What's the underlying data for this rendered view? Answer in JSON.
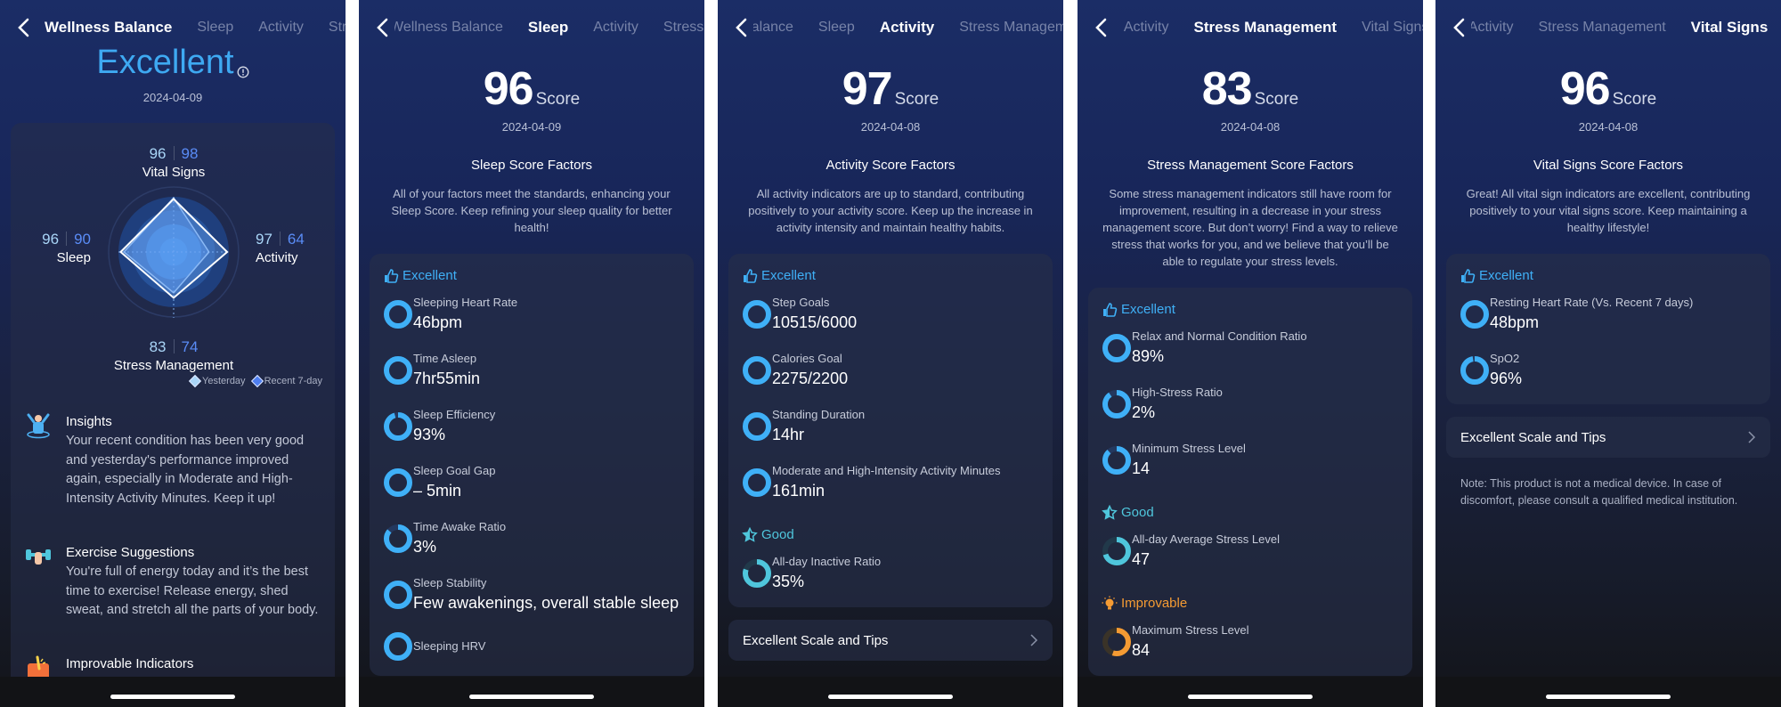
{
  "tabs": [
    "Wellness Balance",
    "Sleep",
    "Activity",
    "Stress Management",
    "Vital Signs"
  ],
  "colors": {
    "excellent": "#3fb0f7",
    "good": "#4fc6dc",
    "improvable": "#f59b33",
    "rating": "#3ea9f2",
    "yesterday": "#a9d5f7",
    "recent": "#4f7ff0"
  },
  "overview": {
    "active_tab": 0,
    "rating": "Excellent",
    "date": "2024-04-09",
    "radar": {
      "axes": [
        {
          "label": "Vital Signs",
          "yesterday": 96,
          "recent": 98
        },
        {
          "label": "Activity",
          "yesterday": 97,
          "recent": 64
        },
        {
          "label": "Stress Management",
          "yesterday": 83,
          "recent": 74
        },
        {
          "label": "Sleep",
          "yesterday": 96,
          "recent": 90
        }
      ],
      "legend": {
        "yesterday": "Yesterday",
        "recent": "Recent 7-day"
      }
    },
    "insights": [
      {
        "icon": "person-cheering-icon",
        "title": "Insights",
        "body": "Your recent condition has been very good and yesterday's performance improved again, especially in Moderate and High-Intensity Activity Minutes. Keep it up!"
      },
      {
        "icon": "dumbbell-icon",
        "title": "Exercise Suggestions",
        "body": "You're full of energy today and it’s the best time to exercise! Release energy, shed sweat, and stretch all the parts of your body."
      },
      {
        "icon": "alert-box-icon",
        "title": "Improvable Indicators",
        "body": ""
      }
    ]
  },
  "details": [
    {
      "active_tab": 1,
      "score": "96",
      "score_label": "Score",
      "date": "2024-04-09",
      "factors_title": "Sleep Score Factors",
      "description": "All of your factors meet the standards, enhancing your Sleep Score. Keep refining your sleep quality for better health!",
      "groups": [
        {
          "level": "Excellent",
          "kind": "excellent",
          "items": [
            {
              "label": "Sleeping Heart Rate",
              "value": "46bpm",
              "progress": 1
            },
            {
              "label": "Time Asleep",
              "value": "7hr55min",
              "progress": 1
            },
            {
              "label": "Sleep Efficiency",
              "value": "93%",
              "progress": 0.95
            },
            {
              "label": "Sleep Goal Gap",
              "value": "– 5min",
              "progress": 1
            },
            {
              "label": "Time Awake Ratio",
              "value": "3%",
              "progress": 0.86
            },
            {
              "label": "Sleep Stability",
              "value": "Few awakenings, overall stable sleep",
              "progress": 1
            },
            {
              "label": "Sleeping HRV",
              "value": "",
              "progress": 1
            }
          ]
        }
      ]
    },
    {
      "active_tab": 2,
      "score": "97",
      "score_label": "Score",
      "date": "2024-04-08",
      "factors_title": "Activity Score Factors",
      "description": "All activity indicators are up to standard, contributing positively to your activity score. Keep up the increase in activity intensity and maintain healthy habits.",
      "groups": [
        {
          "level": "Excellent",
          "kind": "excellent",
          "items": [
            {
              "label": "Step Goals",
              "value": "10515/6000",
              "progress": 1
            },
            {
              "label": "Calories Goal",
              "value": "2275/2200",
              "progress": 1
            },
            {
              "label": "Standing Duration",
              "value": "14hr",
              "progress": 1
            },
            {
              "label": "Moderate and High-Intensity Activity Minutes",
              "value": "161min",
              "progress": 1
            }
          ]
        },
        {
          "level": "Good",
          "kind": "good",
          "items": [
            {
              "label": "All-day Inactive Ratio",
              "value": "35%",
              "progress": 0.8
            }
          ]
        }
      ],
      "tips_label": "Excellent Scale and Tips"
    },
    {
      "active_tab": 3,
      "score": "83",
      "score_label": "Score",
      "date": "2024-04-08",
      "factors_title": "Stress Management Score Factors",
      "description": "Some stress management indicators still have room for improvement, resulting in a decrease in your stress management score. But don’t worry! Find a way to relieve stress that works for you, and we believe that you’ll be able to regulate your stress levels.",
      "groups": [
        {
          "level": "Excellent",
          "kind": "excellent",
          "items": [
            {
              "label": "Relax and Normal Condition Ratio",
              "value": "89%",
              "progress": 1
            },
            {
              "label": "High-Stress Ratio",
              "value": "2%",
              "progress": 0.9
            },
            {
              "label": "Minimum Stress Level",
              "value": "14",
              "progress": 0.88
            }
          ]
        },
        {
          "level": "Good",
          "kind": "good",
          "items": [
            {
              "label": "All-day Average Stress Level",
              "value": "47",
              "progress": 0.7
            }
          ]
        },
        {
          "level": "Improvable",
          "kind": "improvable",
          "items": [
            {
              "label": "Maximum Stress Level",
              "value": "84",
              "progress": 0.55
            }
          ]
        }
      ]
    },
    {
      "active_tab": 4,
      "score": "96",
      "score_label": "Score",
      "date": "2024-04-08",
      "factors_title": "Vital Signs Score Factors",
      "description": "Great! All vital sign indicators are excellent, contributing positively to your vital signs score. Keep maintaining a healthy lifestyle!",
      "groups": [
        {
          "level": "Excellent",
          "kind": "excellent",
          "items": [
            {
              "label": "Resting Heart Rate (Vs. Recent 7 days)",
              "value": "48bpm",
              "progress": 1
            },
            {
              "label": "SpO2",
              "value": "96%",
              "progress": 0.97
            }
          ]
        }
      ],
      "tips_label": "Excellent Scale and Tips",
      "note": "Note: This product is not a medical device. In case of discomfort, please consult a qualified medical institution."
    }
  ]
}
